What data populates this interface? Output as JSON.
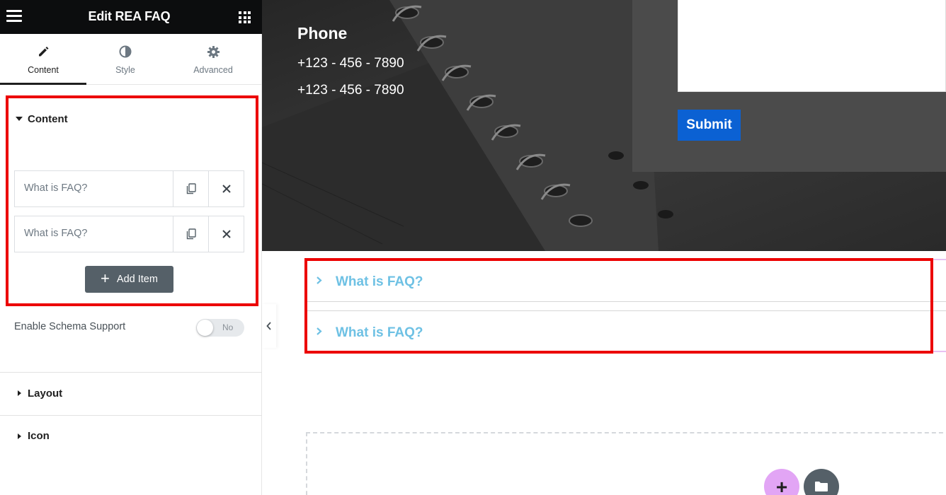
{
  "panel": {
    "title": "Edit REA FAQ",
    "tabs": [
      {
        "label": "Content",
        "icon": "pencil-icon",
        "active": true
      },
      {
        "label": "Style",
        "icon": "contrast-icon",
        "active": false
      },
      {
        "label": "Advanced",
        "icon": "gear-icon",
        "active": false
      }
    ],
    "content_section": {
      "label": "Content",
      "items": [
        {
          "title": "What is FAQ?"
        },
        {
          "title": "What is FAQ?"
        }
      ],
      "add_item_label": "Add Item"
    },
    "schema": {
      "label": "Enable Schema Support",
      "toggle_label": "No",
      "enabled": false
    },
    "sections": [
      {
        "label": "Layout"
      },
      {
        "label": "Icon"
      }
    ]
  },
  "preview": {
    "contact": {
      "title": "Phone",
      "lines": [
        "+123 - 456 - 7890",
        "+123 - 456 - 7890"
      ]
    },
    "form": {
      "submit_label": "Submit"
    },
    "faq": [
      {
        "question": "What is FAQ?"
      },
      {
        "question": "What is FAQ?"
      }
    ],
    "add_section_label": "+"
  },
  "colors": {
    "header_bg": "#0c0d0e",
    "highlight_red": "#ec0000",
    "faq_title": "#6ec1e4",
    "submit_bg": "#0b61d3",
    "add_section_bg": "#e2a5f5"
  }
}
